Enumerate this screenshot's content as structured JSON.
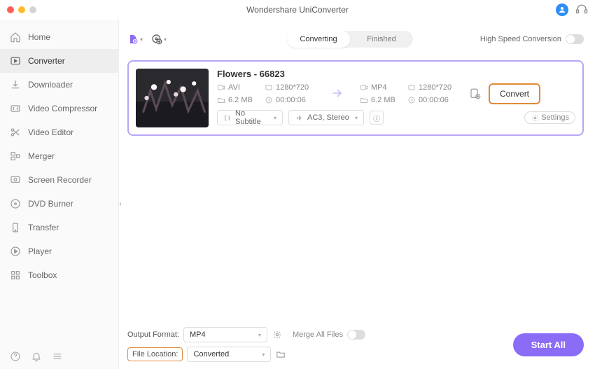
{
  "app": {
    "title": "Wondershare UniConverter"
  },
  "sidebar": {
    "items": [
      {
        "label": "Home"
      },
      {
        "label": "Converter"
      },
      {
        "label": "Downloader"
      },
      {
        "label": "Video Compressor"
      },
      {
        "label": "Video Editor"
      },
      {
        "label": "Merger"
      },
      {
        "label": "Screen Recorder"
      },
      {
        "label": "DVD Burner"
      },
      {
        "label": "Transfer"
      },
      {
        "label": "Player"
      },
      {
        "label": "Toolbox"
      }
    ]
  },
  "tabs": {
    "converting": "Converting",
    "finished": "Finished"
  },
  "hsc_label": "High Speed Conversion",
  "file": {
    "title": "Flowers - 66823",
    "src": {
      "format": "AVI",
      "resolution": "1280*720",
      "size": "6.2 MB",
      "duration": "00:00:06"
    },
    "dst": {
      "format": "MP4",
      "resolution": "1280*720",
      "size": "6.2 MB",
      "duration": "00:00:06"
    },
    "subtitle_label": "No Subtitle",
    "audio_label": "AC3, Stereo",
    "settings_label": "Settings",
    "convert_label": "Convert"
  },
  "bottom": {
    "output_format_label": "Output Format:",
    "output_format_value": "MP4",
    "file_location_label": "File Location:",
    "file_location_value": "Converted",
    "merge_label": "Merge All Files",
    "start_label": "Start All"
  }
}
